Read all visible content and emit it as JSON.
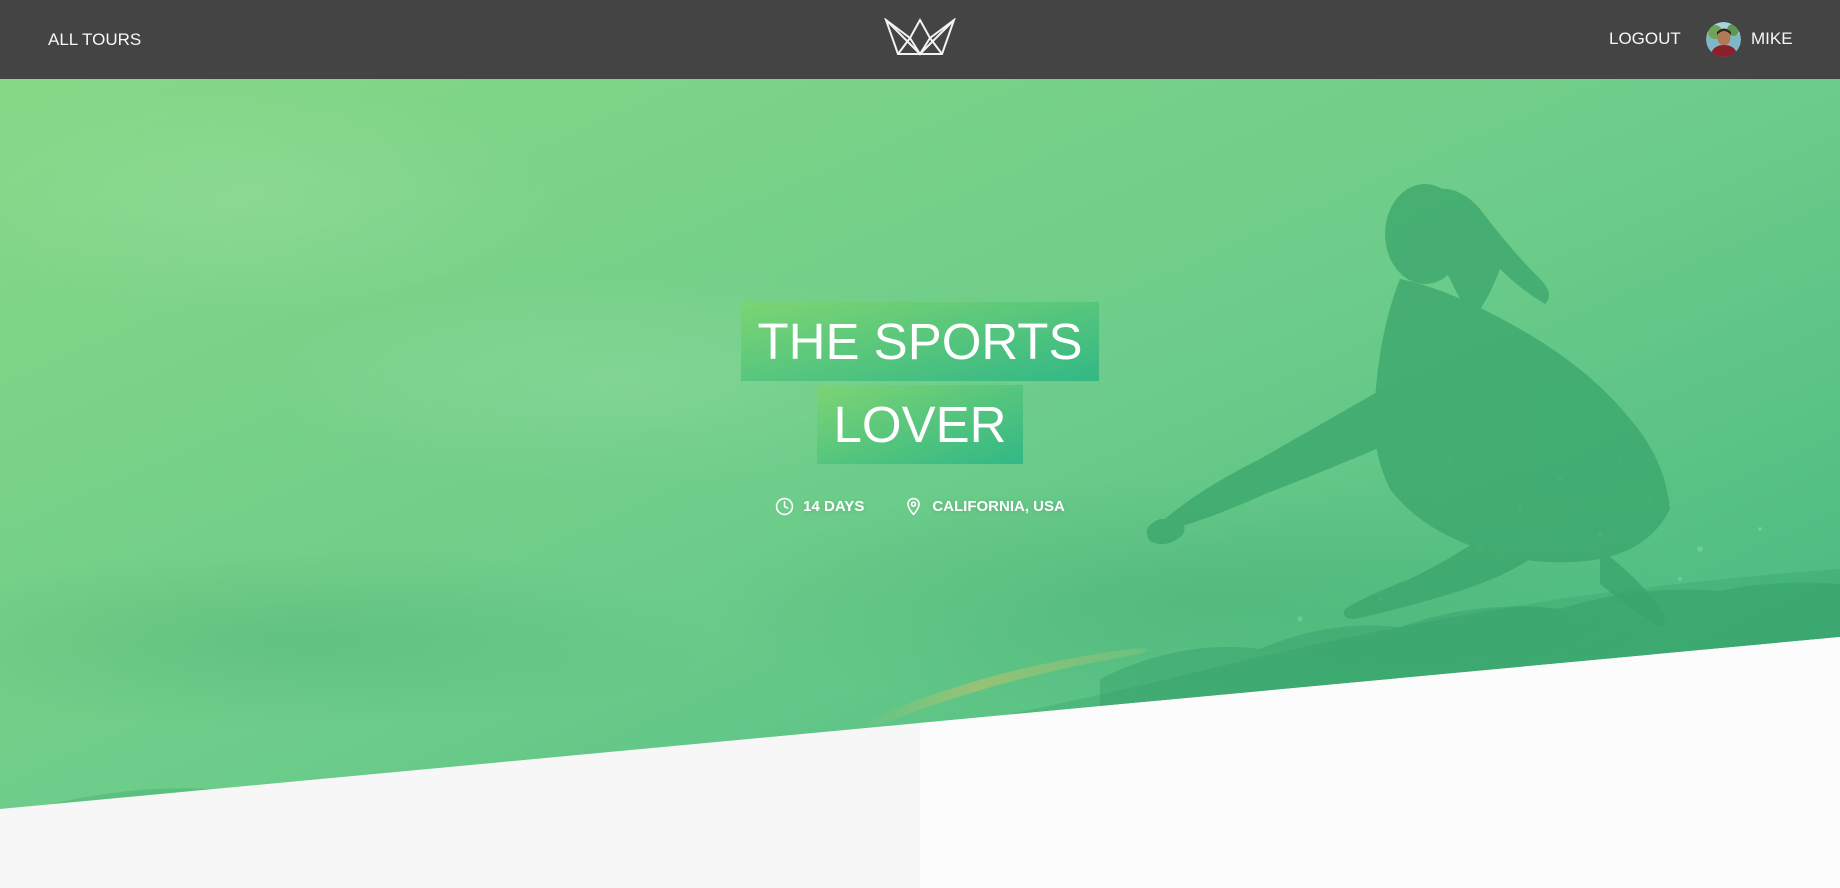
{
  "header": {
    "all_tours": "ALL TOURS",
    "logout": "LOGOUT",
    "user_name": "MIKE"
  },
  "tour": {
    "name_line1": "THE SPORTS",
    "name_line2": "LOVER",
    "duration": "14 DAYS",
    "location": "CALIFORNIA, USA"
  },
  "icons": {
    "logo": "crown-logo-icon",
    "duration": "clock-icon",
    "location": "map-pin-icon",
    "avatar": "user-avatar"
  },
  "colors": {
    "header_bg": "#444444",
    "green_light": "#7dd56f",
    "green_dark": "#28b487",
    "text_light": "#f7f7f7"
  }
}
